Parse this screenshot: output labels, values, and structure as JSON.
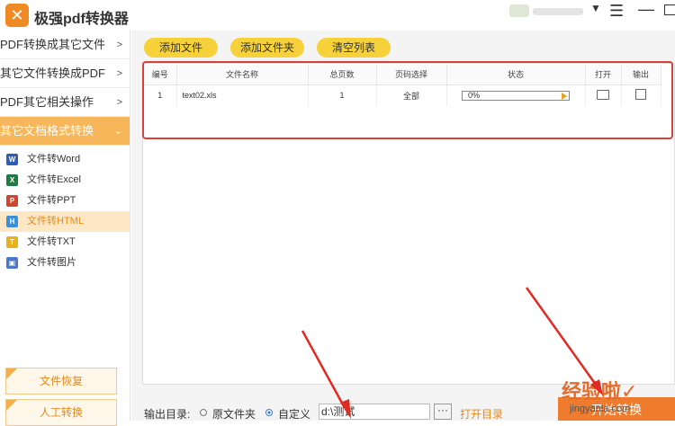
{
  "app": {
    "title": "极强pdf转换器"
  },
  "sidebar": {
    "nav": [
      {
        "label": "PDF转换成其它文件"
      },
      {
        "label": "其它文件转换成PDF"
      },
      {
        "label": "PDF其它相关操作"
      },
      {
        "label": "其它文档格式转换"
      }
    ],
    "sub_items": [
      {
        "label": "文件转Word",
        "icon": "word-icon",
        "color": "#2b5eb9"
      },
      {
        "label": "文件转Excel",
        "icon": "excel-icon",
        "color": "#1f7a44"
      },
      {
        "label": "文件转PPT",
        "icon": "ppt-icon",
        "color": "#d0452d"
      },
      {
        "label": "文件转HTML",
        "icon": "html-icon",
        "color": "#3b8fd6"
      },
      {
        "label": "文件转TXT",
        "icon": "txt-icon",
        "color": "#e9b21a"
      },
      {
        "label": "文件转图片",
        "icon": "image-icon",
        "color": "#4d77c9"
      }
    ],
    "file_recovery": "文件恢复",
    "manual": "人工转换"
  },
  "toolbar": {
    "add_file": "添加文件",
    "add_folder": "添加文件夹",
    "clear_list": "清空列表"
  },
  "table": {
    "headers": [
      "编号",
      "文件名称",
      "总页数",
      "页码选择",
      "状态",
      "打开",
      "输出"
    ],
    "rows": [
      {
        "index": "1",
        "name": "text02.xls",
        "pages": "1",
        "range": "全部",
        "status": "0%"
      }
    ]
  },
  "output": {
    "label": "输出目录:",
    "option_original": "原文件夹",
    "option_custom": "自定义",
    "path": "d:\\测试",
    "browse": "···",
    "open_dir": "打开目录"
  },
  "start_button": "开始转换",
  "watermark": {
    "main": "经验啦✓",
    "sub": "jingyanla.com"
  },
  "colors": {
    "accent": "#f8b65a",
    "highlight": "#d9413b",
    "button": "#f6d13a"
  }
}
